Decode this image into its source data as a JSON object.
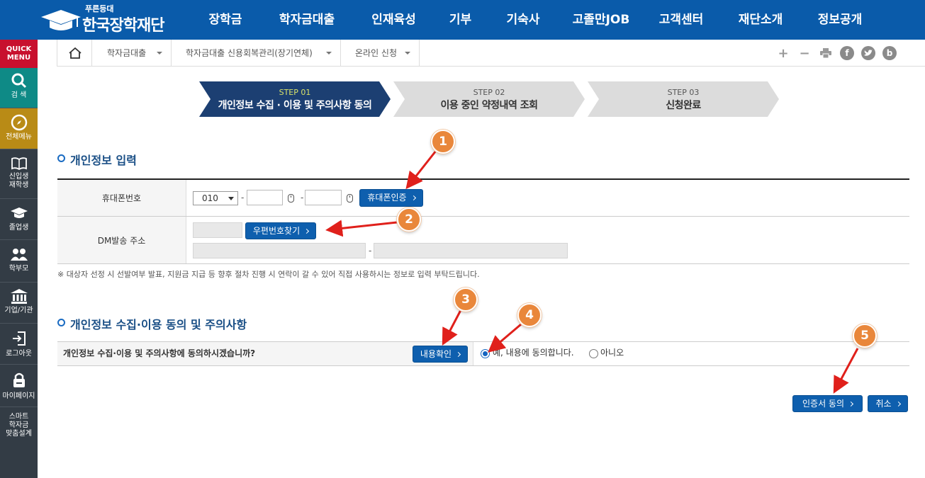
{
  "brand": {
    "subtitle": "푸른등대",
    "name": "한국장학재단"
  },
  "gnb": [
    "장학금",
    "학자금대출",
    "인재육성",
    "기부",
    "기숙사",
    "고졸만JOB",
    "고객센터",
    "재단소개",
    "정보공개"
  ],
  "quick_menu": {
    "title_line1": "QUICK",
    "title_line2": "MENU",
    "items": [
      {
        "label": "검 색",
        "icon": "search-icon"
      },
      {
        "label": "전체메뉴",
        "icon": "compass-icon"
      },
      {
        "label_line1": "신입생",
        "label_line2": "재학생",
        "icon": "book-icon"
      },
      {
        "label": "졸업생",
        "icon": "graduation-cap-icon"
      },
      {
        "label": "학부모",
        "icon": "parents-icon"
      },
      {
        "label": "기업/기관",
        "icon": "institution-icon"
      },
      {
        "label": "로그아웃",
        "icon": "logout-icon"
      },
      {
        "label": "마이페이지",
        "icon": "lock-icon"
      },
      {
        "label_line1": "스마트",
        "label_line2": "학자금",
        "label_line3": "맞춤설계"
      }
    ]
  },
  "breadcrumb": {
    "home_icon": "home-icon",
    "items": [
      "학자금대출",
      "학자금대출 신용회복관리(장기연체)",
      "온라인 신청"
    ]
  },
  "tools": {
    "zoom_in": "+",
    "zoom_out": "−",
    "print_icon": "print-icon",
    "facebook": "f",
    "twitter_icon": "twitter-icon",
    "blog": "b"
  },
  "steps": [
    {
      "num": "STEP 01",
      "name": "개인정보 수집 · 이용 및 주의사항 동의",
      "active": true
    },
    {
      "num": "STEP 02",
      "name": "이용 중인 약정내역 조회",
      "active": false
    },
    {
      "num": "STEP 03",
      "name": "신청완료",
      "active": false
    }
  ],
  "section1": {
    "title": "개인정보 입력",
    "phone_label": "휴대폰번호",
    "phone_prefix": "010",
    "phone_verify_button": "휴대폰인증",
    "dm_label": "DM발송 주소",
    "zip_search_button": "우편번호찾기",
    "dash": "-",
    "note": "※ 대상자 선정 시 선발여부 발표, 지원금 지급 등 향후 절차 진행 시 연락이 갈 수 있어 직접 사용하시는 정보로 입력 부탁드립니다."
  },
  "section2": {
    "title": "개인정보 수집·이용 동의 및 주의사항",
    "question": "개인정보 수집·이용 및 주의사항에 동의하시겠습니까?",
    "view_button": "내용확인",
    "agree_label": "예, 내용에 동의합니다.",
    "disagree_label": "아니오",
    "agree_selected": true
  },
  "actions": {
    "cert_agree_button": "인증서 동의",
    "cancel_button": "취소"
  },
  "badges": [
    "1",
    "2",
    "3",
    "4",
    "5"
  ],
  "colors": {
    "brand_blue": "#0a5baa",
    "button_blue": "#0e5fae",
    "step_active": "#1c3f72",
    "step_inactive": "#dcdcdc",
    "badge_orange": "#e9873b",
    "arrow_red": "#e0201b",
    "quick_red": "#c8102e",
    "sidebar_dark": "#333c45"
  }
}
